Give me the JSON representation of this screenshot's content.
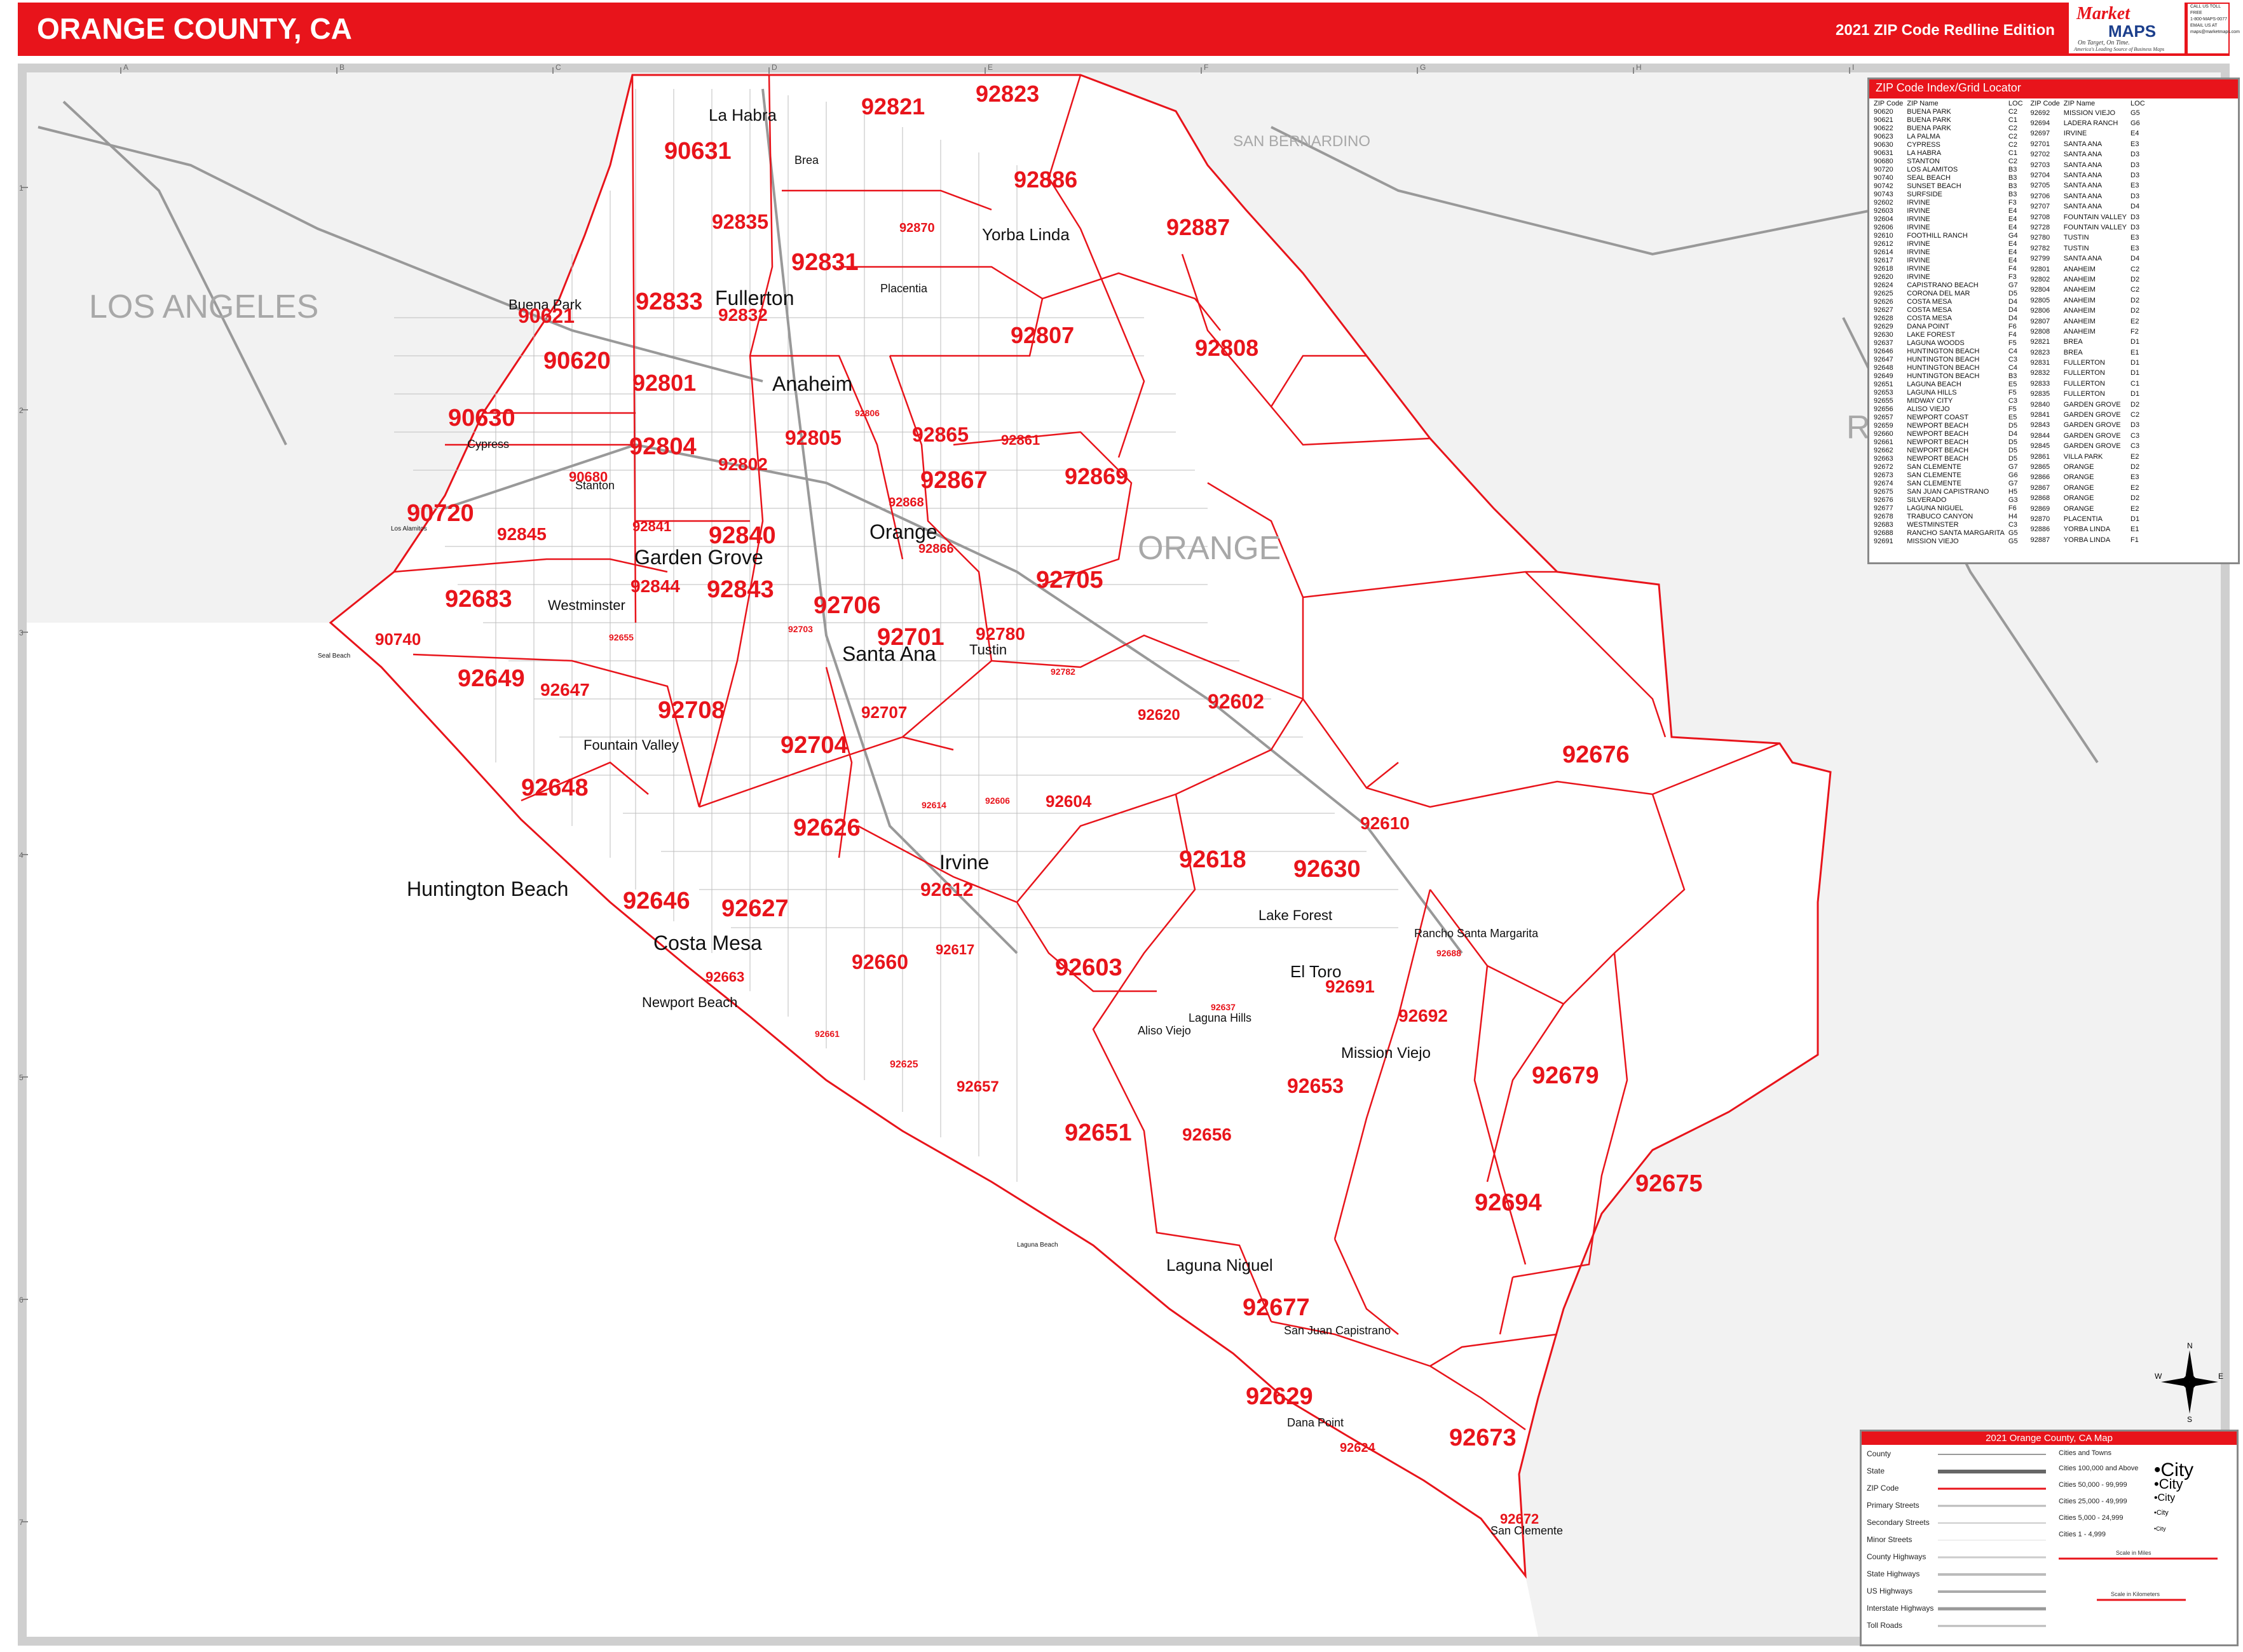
{
  "header": {
    "title": "ORANGE COUNTY, CA",
    "edition": "2021 ZIP Code Redline Edition",
    "logo_top": "Market",
    "logo_bottom": "MAPS",
    "logo_tagline": "On Target, On Time.",
    "logo_tagline2": "America's Leading Source of Business Maps",
    "contact": [
      "CALL US TOLL FREE",
      "1-800-MAPS-0077",
      "EMAIL US AT",
      "maps@marketmaps.com"
    ]
  },
  "colors": {
    "accent": "#e8141b",
    "county_fill": "#ffffff",
    "outside_fill": "#eeeeee"
  },
  "region_labels": [
    {
      "text": "LOS ANGELES"
    },
    {
      "text": "SAN BERNARDINO"
    },
    {
      "text": "ORANGE"
    },
    {
      "text": "R"
    }
  ],
  "grid_letters": [
    "A",
    "B",
    "C",
    "D",
    "E",
    "F",
    "G",
    "H",
    "I"
  ],
  "grid_numbers": [
    "1",
    "2",
    "3",
    "4",
    "5",
    "6",
    "7"
  ],
  "cities": [
    {
      "name": "La Habra"
    },
    {
      "name": "Brea"
    },
    {
      "name": "Yorba Linda"
    },
    {
      "name": "Placentia"
    },
    {
      "name": "Buena Park"
    },
    {
      "name": "Fullerton"
    },
    {
      "name": "Anaheim"
    },
    {
      "name": "Cypress"
    },
    {
      "name": "Stanton"
    },
    {
      "name": "Garden Grove"
    },
    {
      "name": "Orange"
    },
    {
      "name": "Westminster"
    },
    {
      "name": "Santa Ana"
    },
    {
      "name": "Tustin"
    },
    {
      "name": "Fountain Valley"
    },
    {
      "name": "Huntington Beach"
    },
    {
      "name": "Irvine"
    },
    {
      "name": "Costa Mesa"
    },
    {
      "name": "Newport Beach"
    },
    {
      "name": "Lake Forest"
    },
    {
      "name": "El Toro"
    },
    {
      "name": "Rancho Santa Margarita"
    },
    {
      "name": "Mission Viejo"
    },
    {
      "name": "Aliso Viejo"
    },
    {
      "name": "Laguna Hills"
    },
    {
      "name": "Laguna Niguel"
    },
    {
      "name": "San Juan Capistrano"
    },
    {
      "name": "Dana Point"
    },
    {
      "name": "San Clemente"
    },
    {
      "name": "Laguna Beach"
    },
    {
      "name": "Seal Beach"
    },
    {
      "name": "Los Alamitos"
    }
  ],
  "zip_labels": [
    "92821",
    "92823",
    "90631",
    "92886",
    "92835",
    "92870",
    "92887",
    "92831",
    "92833",
    "90621",
    "90620",
    "92832",
    "92807",
    "92808",
    "92801",
    "90630",
    "92806",
    "92865",
    "92861",
    "92804",
    "92805",
    "92869",
    "92802",
    "92867",
    "90680",
    "92868",
    "90720",
    "92841",
    "92845",
    "92840",
    "92866",
    "92705",
    "92683",
    "92844",
    "92843",
    "92706",
    "92701",
    "92780",
    "90740",
    "92655",
    "92703",
    "92782",
    "92649",
    "92647",
    "92708",
    "92707",
    "92602",
    "92620",
    "92704",
    "92648",
    "92614",
    "92606",
    "92604",
    "92676",
    "92626",
    "92610",
    "92618",
    "92630",
    "92612",
    "92646",
    "92627",
    "92617",
    "92660",
    "92663",
    "92603",
    "92691",
    "92637",
    "92692",
    "92661",
    "92625",
    "92657",
    "92653",
    "92679",
    "92651",
    "92656",
    "92694",
    "92675",
    "92677",
    "92629",
    "92624",
    "92673",
    "92672",
    "92688"
  ],
  "index": {
    "title": "ZIP Code Index/Grid Locator",
    "headers": [
      "ZIP Code",
      "ZIP Name",
      "LOC"
    ],
    "left": [
      [
        "90620",
        "BUENA PARK",
        "C2"
      ],
      [
        "90621",
        "BUENA PARK",
        "C1"
      ],
      [
        "90622",
        "BUENA PARK",
        "C2"
      ],
      [
        "90623",
        "LA PALMA",
        "C2"
      ],
      [
        "90630",
        "CYPRESS",
        "C2"
      ],
      [
        "90631",
        "LA HABRA",
        "C1"
      ],
      [
        "90680",
        "STANTON",
        "C2"
      ],
      [
        "90720",
        "LOS ALAMITOS",
        "B3"
      ],
      [
        "90740",
        "SEAL BEACH",
        "B3"
      ],
      [
        "90742",
        "SUNSET BEACH",
        "B3"
      ],
      [
        "90743",
        "SURFSIDE",
        "B3"
      ],
      [
        "92602",
        "IRVINE",
        "F3"
      ],
      [
        "92603",
        "IRVINE",
        "E4"
      ],
      [
        "92604",
        "IRVINE",
        "E4"
      ],
      [
        "92606",
        "IRVINE",
        "E4"
      ],
      [
        "92610",
        "FOOTHILL RANCH",
        "G4"
      ],
      [
        "92612",
        "IRVINE",
        "E4"
      ],
      [
        "92614",
        "IRVINE",
        "E4"
      ],
      [
        "92617",
        "IRVINE",
        "E4"
      ],
      [
        "92618",
        "IRVINE",
        "F4"
      ],
      [
        "92620",
        "IRVINE",
        "F3"
      ],
      [
        "92624",
        "CAPISTRANO BEACH",
        "G7"
      ],
      [
        "92625",
        "CORONA DEL MAR",
        "D5"
      ],
      [
        "92626",
        "COSTA MESA",
        "D4"
      ],
      [
        "92627",
        "COSTA MESA",
        "D4"
      ],
      [
        "92628",
        "COSTA MESA",
        "D4"
      ],
      [
        "92629",
        "DANA POINT",
        "F6"
      ],
      [
        "92630",
        "LAKE FOREST",
        "F4"
      ],
      [
        "92637",
        "LAGUNA WOODS",
        "F5"
      ],
      [
        "92646",
        "HUNTINGTON BEACH",
        "C4"
      ],
      [
        "92647",
        "HUNTINGTON BEACH",
        "C3"
      ],
      [
        "92648",
        "HUNTINGTON BEACH",
        "C4"
      ],
      [
        "92649",
        "HUNTINGTON BEACH",
        "B3"
      ],
      [
        "92651",
        "LAGUNA BEACH",
        "E5"
      ],
      [
        "92653",
        "LAGUNA HILLS",
        "F5"
      ],
      [
        "92655",
        "MIDWAY CITY",
        "C3"
      ],
      [
        "92656",
        "ALISO VIEJO",
        "F5"
      ],
      [
        "92657",
        "NEWPORT COAST",
        "E5"
      ],
      [
        "92659",
        "NEWPORT BEACH",
        "D5"
      ],
      [
        "92660",
        "NEWPORT BEACH",
        "D4"
      ],
      [
        "92661",
        "NEWPORT BEACH",
        "D5"
      ],
      [
        "92662",
        "NEWPORT BEACH",
        "D5"
      ],
      [
        "92663",
        "NEWPORT BEACH",
        "D5"
      ],
      [
        "92672",
        "SAN CLEMENTE",
        "G7"
      ],
      [
        "92673",
        "SAN CLEMENTE",
        "G6"
      ],
      [
        "92674",
        "SAN CLEMENTE",
        "G7"
      ],
      [
        "92675",
        "SAN JUAN CAPISTRANO",
        "H5"
      ],
      [
        "92676",
        "SILVERADO",
        "G3"
      ],
      [
        "92677",
        "LAGUNA NIGUEL",
        "F6"
      ],
      [
        "92678",
        "TRABUCO CANYON",
        "H4"
      ],
      [
        "92683",
        "WESTMINSTER",
        "C3"
      ],
      [
        "92688",
        "RANCHO SANTA MARGARITA",
        "G5"
      ],
      [
        "92691",
        "MISSION VIEJO",
        "G5"
      ]
    ],
    "right": [
      [
        "92692",
        "MISSION VIEJO",
        "G5"
      ],
      [
        "92694",
        "LADERA RANCH",
        "G6"
      ],
      [
        "92697",
        "IRVINE",
        "E4"
      ],
      [
        "92701",
        "SANTA ANA",
        "E3"
      ],
      [
        "92702",
        "SANTA ANA",
        "D3"
      ],
      [
        "92703",
        "SANTA ANA",
        "D3"
      ],
      [
        "92704",
        "SANTA ANA",
        "D3"
      ],
      [
        "92705",
        "SANTA ANA",
        "E3"
      ],
      [
        "92706",
        "SANTA ANA",
        "D3"
      ],
      [
        "92707",
        "SANTA ANA",
        "D4"
      ],
      [
        "92708",
        "FOUNTAIN VALLEY",
        "D3"
      ],
      [
        "92728",
        "FOUNTAIN VALLEY",
        "D3"
      ],
      [
        "92780",
        "TUSTIN",
        "E3"
      ],
      [
        "92782",
        "TUSTIN",
        "E3"
      ],
      [
        "92799",
        "SANTA ANA",
        "D4"
      ],
      [
        "92801",
        "ANAHEIM",
        "C2"
      ],
      [
        "92802",
        "ANAHEIM",
        "D2"
      ],
      [
        "92804",
        "ANAHEIM",
        "C2"
      ],
      [
        "92805",
        "ANAHEIM",
        "D2"
      ],
      [
        "92806",
        "ANAHEIM",
        "D2"
      ],
      [
        "92807",
        "ANAHEIM",
        "E2"
      ],
      [
        "92808",
        "ANAHEIM",
        "F2"
      ],
      [
        "92821",
        "BREA",
        "D1"
      ],
      [
        "92823",
        "BREA",
        "E1"
      ],
      [
        "92831",
        "FULLERTON",
        "D1"
      ],
      [
        "92832",
        "FULLERTON",
        "D1"
      ],
      [
        "92833",
        "FULLERTON",
        "C1"
      ],
      [
        "92835",
        "FULLERTON",
        "D1"
      ],
      [
        "92840",
        "GARDEN GROVE",
        "D2"
      ],
      [
        "92841",
        "GARDEN GROVE",
        "C2"
      ],
      [
        "92843",
        "GARDEN GROVE",
        "D3"
      ],
      [
        "92844",
        "GARDEN GROVE",
        "C3"
      ],
      [
        "92845",
        "GARDEN GROVE",
        "C3"
      ],
      [
        "92861",
        "VILLA PARK",
        "E2"
      ],
      [
        "92865",
        "ORANGE",
        "D2"
      ],
      [
        "92866",
        "ORANGE",
        "E3"
      ],
      [
        "92867",
        "ORANGE",
        "E2"
      ],
      [
        "92868",
        "ORANGE",
        "D2"
      ],
      [
        "92869",
        "ORANGE",
        "E2"
      ],
      [
        "92870",
        "PLACENTIA",
        "D1"
      ],
      [
        "92886",
        "YORBA LINDA",
        "E1"
      ],
      [
        "92887",
        "YORBA LINDA",
        "F1"
      ]
    ]
  },
  "legend": {
    "title": "2021 Orange County, CA Map",
    "rows": [
      "County",
      "State",
      "ZIP Code",
      "Primary Streets",
      "Secondary Streets",
      "Minor Streets",
      "County Highways",
      "State Highways",
      "US Highways",
      "Interstate Highways",
      "Toll Roads"
    ],
    "cities_title": "Cities and Towns",
    "city_rows": [
      "Cities 100,000 and Above",
      "Cities 50,000 - 99,999",
      "Cities 25,000 - 49,999",
      "Cities 5,000 - 24,999",
      "Cities 1 - 4,999"
    ],
    "city_symbol": "City",
    "scale_miles": "Scale in Miles",
    "scale_km": "Scale in Kilometers"
  },
  "compass": {
    "n": "N",
    "s": "S",
    "e": "E",
    "w": "W"
  }
}
